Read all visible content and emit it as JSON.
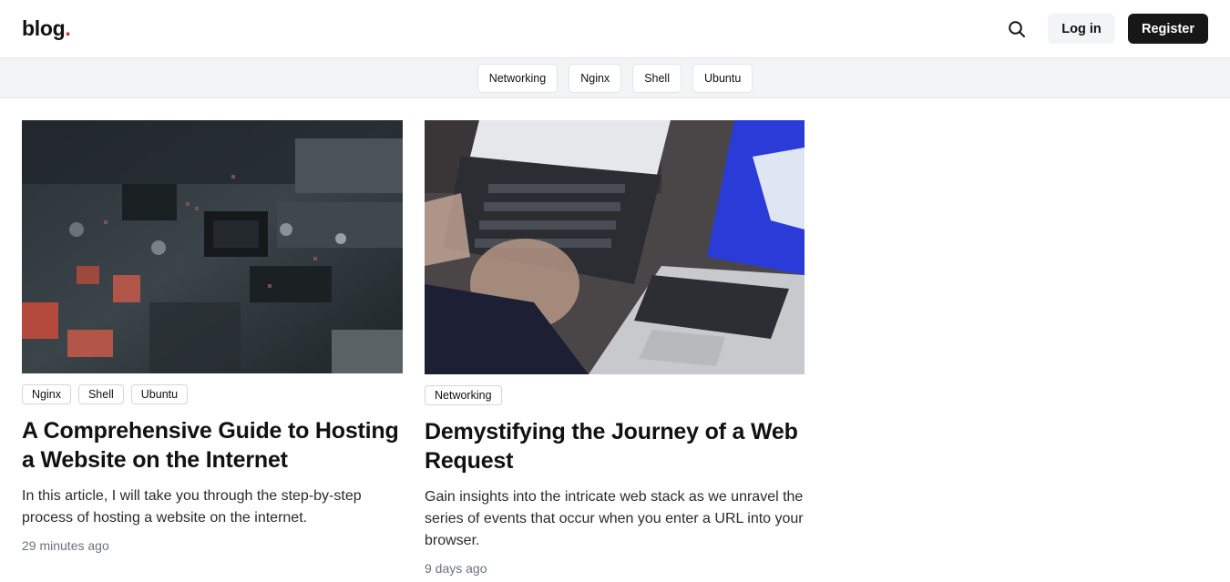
{
  "header": {
    "logo_text": "blog",
    "logo_dot": ".",
    "login_label": "Log in",
    "register_label": "Register"
  },
  "tagbar": {
    "tags": [
      "Networking",
      "Nginx",
      "Shell",
      "Ubuntu"
    ]
  },
  "posts": [
    {
      "tags": [
        "Nginx",
        "Shell",
        "Ubuntu"
      ],
      "title": "A Comprehensive Guide to Hosting a Website on the Internet",
      "description": "In this article, I will take you through the step-by-step process of hosting a website on the internet.",
      "time": "29 minutes ago",
      "image_icon": "circuit-board-photo"
    },
    {
      "tags": [
        "Networking"
      ],
      "title": "Demystifying the Journey of a Web Request",
      "description": "Gain insights into the intricate web stack as we unravel the series of events that occur when you enter a URL into your browser.",
      "time": "9 days ago",
      "image_icon": "laptops-photo"
    }
  ],
  "colors": {
    "accent_dot": "#dc2626",
    "register_bg": "#171717",
    "tagbar_bg": "#f3f4f6"
  }
}
